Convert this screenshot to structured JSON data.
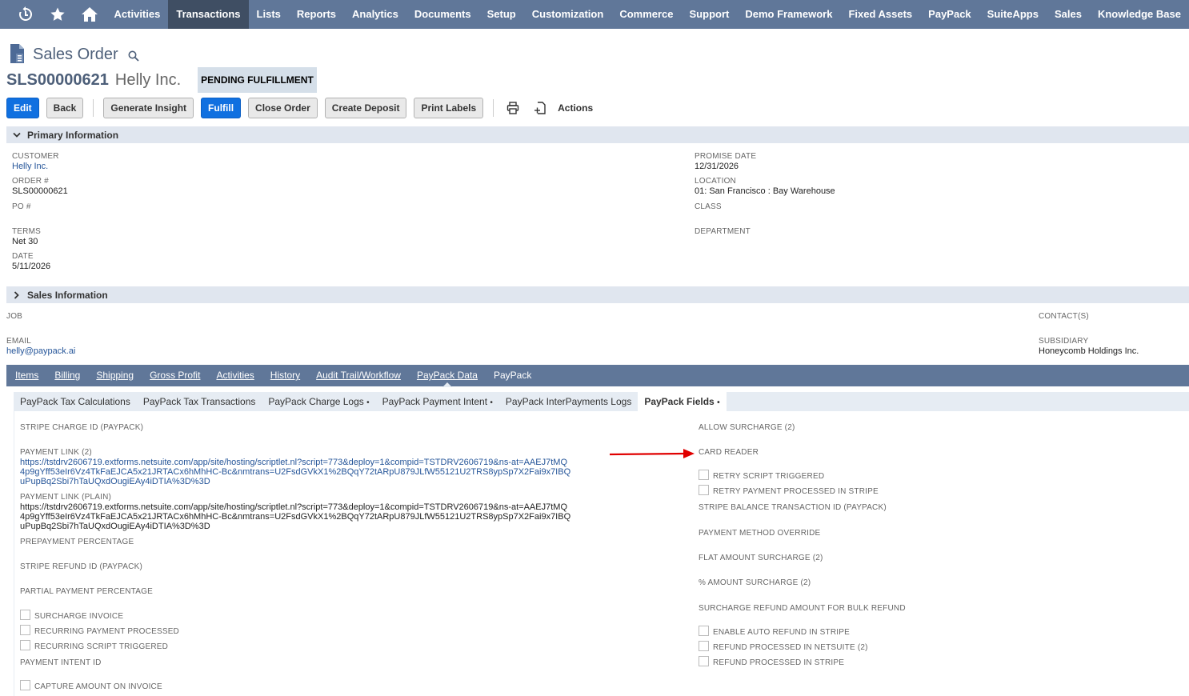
{
  "nav": {
    "items": [
      "Activities",
      "Transactions",
      "Lists",
      "Reports",
      "Analytics",
      "Documents",
      "Setup",
      "Customization",
      "Commerce",
      "Support",
      "Demo Framework",
      "Fixed Assets",
      "PayPack",
      "SuiteApps",
      "Sales",
      "Knowledge Base"
    ],
    "active": "Transactions",
    "icons": [
      "recent-icon",
      "star-icon",
      "home-icon"
    ]
  },
  "header": {
    "page_title": "Sales Order",
    "record_number": "SLS00000621",
    "record_name": "Helly Inc.",
    "status": "PENDING FULFILLMENT"
  },
  "buttons": {
    "edit": "Edit",
    "back": "Back",
    "generate_insight": "Generate Insight",
    "fulfill": "Fulfill",
    "close_order": "Close Order",
    "create_deposit": "Create Deposit",
    "print_labels": "Print Labels",
    "actions": "Actions"
  },
  "primary": {
    "title": "Primary Information",
    "customer_label": "CUSTOMER",
    "customer": "Helly Inc.",
    "order_label": "ORDER #",
    "order": "SLS00000621",
    "po_label": "PO #",
    "terms_label": "TERMS",
    "terms": "Net 30",
    "date_label": "DATE",
    "date": "5/11/2026",
    "promise_label": "PROMISE DATE",
    "promise": "12/31/2026",
    "location_label": "LOCATION",
    "location": "01: San Francisco : Bay Warehouse",
    "class_label": "CLASS",
    "department_label": "DEPARTMENT"
  },
  "sales": {
    "title": "Sales Information",
    "job_label": "JOB",
    "email_label": "EMAIL",
    "email": "helly@paypack.ai",
    "contacts_label": "CONTACT(S)",
    "subsidiary_label": "SUBSIDIARY",
    "subsidiary": "Honeycomb Holdings Inc."
  },
  "tabs": {
    "main": [
      "Items",
      "Billing",
      "Shipping",
      "Gross Profit",
      "Activities",
      "History",
      "Audit Trail/Workflow",
      "PayPack Data",
      "PayPack"
    ],
    "main_active": "PayPack Data",
    "sub": [
      "PayPack Tax Calculations",
      "PayPack Tax Transactions",
      "PayPack Charge Logs",
      "PayPack Payment Intent",
      "PayPack InterPayments Logs",
      "PayPack Fields"
    ],
    "sub_dot": "•"
  },
  "fields": {
    "stripe_charge_id": "STRIPE CHARGE ID (PAYPACK)",
    "payment_link_label": "PAYMENT LINK (2)",
    "payment_link": "https://tstdrv2606719.extforms.netsuite.com/app/site/hosting/scriptlet.nl?script=773&deploy=1&compid=TSTDRV2606719&ns-at=AAEJ7tMQ4p9gYff53eIr6Vz4TkFaEJCA5x21JRTACx6hMhHC-Bc&nmtrans=U2FsdGVkX1%2BQqY72tARpU879JLfW55121U2TRS8ypSp7X2Fai9x7IBQuPupBq2Sbi7hTaUQxdOugiEAy4iDTIA%3D%3D",
    "payment_link_plain_label": "PAYMENT LINK (PLAIN)",
    "payment_link_plain": "https://tstdrv2606719.extforms.netsuite.com/app/site/hosting/scriptlet.nl?script=773&deploy=1&compid=TSTDRV2606719&ns-at=AAEJ7tMQ4p9gYff53eIr6Vz4TkFaEJCA5x21JRTACx6hMhHC-Bc&nmtrans=U2FsdGVkX1%2BQqY72tARpU879JLfW55121U2TRS8ypSp7X2Fai9x7IBQuPupBq2Sbi7hTaUQxdOugiEAy4iDTIA%3D%3D",
    "prepayment_percentage": "PREPAYMENT PERCENTAGE",
    "stripe_refund_id": "STRIPE REFUND ID (PAYPACK)",
    "partial_payment_percentage": "PARTIAL PAYMENT PERCENTAGE",
    "surcharge_invoice": "SURCHARGE INVOICE",
    "recurring_payment_processed": "RECURRING PAYMENT PROCESSED",
    "recurring_script_triggered": "RECURRING SCRIPT TRIGGERED",
    "payment_intent_id": "PAYMENT INTENT ID",
    "capture_amount_on_invoice": "CAPTURE AMOUNT ON INVOICE",
    "allow_surcharge": "ALLOW SURCHARGE (2)",
    "card_reader": "CARD READER",
    "retry_script_triggered": "RETRY SCRIPT TRIGGERED",
    "retry_payment_processed": "RETRY PAYMENT PROCESSED IN STRIPE",
    "stripe_balance_txn_id": "STRIPE BALANCE TRANSACTION ID (PAYPACK)",
    "payment_method_override": "PAYMENT METHOD OVERRIDE",
    "flat_amount_surcharge": "FLAT AMOUNT SURCHARGE (2)",
    "pct_amount_surcharge": "% AMOUNT SURCHARGE (2)",
    "surcharge_refund_bulk": "SURCHARGE REFUND AMOUNT FOR BULK REFUND",
    "enable_auto_refund": "ENABLE AUTO REFUND IN STRIPE",
    "refund_processed_netsuite": "REFUND PROCESSED IN NETSUITE (2)",
    "refund_processed_stripe": "REFUND PROCESSED IN STRIPE"
  },
  "colors": {
    "nav_bg": "#607799",
    "nav_active": "#3f4e63",
    "primary_button": "#1070e0",
    "link": "#255599",
    "section_bg": "#e0e6ef",
    "annotation_arrow": "#e00000"
  }
}
